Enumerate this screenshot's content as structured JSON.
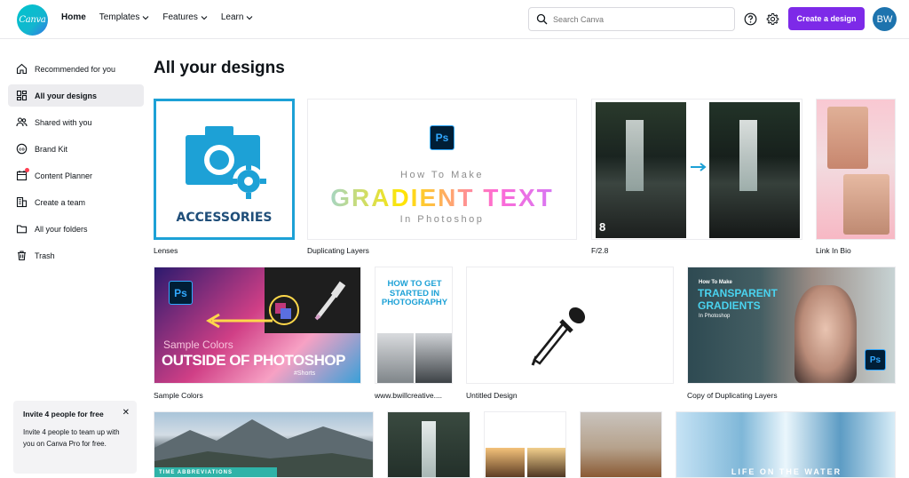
{
  "header": {
    "logo_text": "Canva",
    "nav": [
      {
        "label": "Home",
        "dropdown": false
      },
      {
        "label": "Templates",
        "dropdown": true
      },
      {
        "label": "Features",
        "dropdown": true
      },
      {
        "label": "Learn",
        "dropdown": true
      }
    ],
    "search_placeholder": "Search Canva",
    "create_button": "Create a design",
    "avatar_initials": "BW",
    "accent": "#7d2ae8"
  },
  "sidebar": {
    "items": [
      {
        "label": "Recommended for you",
        "icon": "home-icon"
      },
      {
        "label": "All your designs",
        "icon": "grid-icon",
        "active": true
      },
      {
        "label": "Shared with you",
        "icon": "people-icon"
      },
      {
        "label": "Brand Kit",
        "icon": "brand-kit-icon"
      },
      {
        "label": "Content Planner",
        "icon": "calendar-icon"
      },
      {
        "label": "Create a team",
        "icon": "building-icon"
      },
      {
        "label": "All your folders",
        "icon": "folder-icon"
      },
      {
        "label": "Trash",
        "icon": "trash-icon"
      }
    ],
    "invite": {
      "title": "Invite 4 people for free",
      "body": "Invite 4 people to team up with you on Canva Pro for free."
    }
  },
  "main": {
    "title": "All your designs",
    "designs": [
      {
        "caption": "Lenses",
        "thumb_text": "ACCESSORIES"
      },
      {
        "caption": "Duplicating Layers",
        "thumb_text": [
          "How To Make",
          "GRADIENT TEXT",
          "In Photoshop"
        ],
        "badge": "Ps"
      },
      {
        "caption": "F/2.8",
        "thumb_text": "8"
      },
      {
        "caption": "Link In Bio"
      },
      {
        "caption": "Sample Colors",
        "thumb_text": [
          "Sample Colors",
          "OUTSIDE OF PHOTOSHOP",
          "#Shorts"
        ],
        "badge": "Ps"
      },
      {
        "caption": "www.bwillcreative....",
        "thumb_text": [
          "HOW TO GET STARTED IN PHOTOGRAPHY"
        ]
      },
      {
        "caption": "Untitled Design"
      },
      {
        "caption": "Copy of Duplicating Layers",
        "thumb_text": [
          "How To Make",
          "TRANSPARENT GRADIENTS",
          "In Photoshop"
        ],
        "badge": "Ps"
      },
      {
        "caption": "",
        "thumb_text": "TIME ABBREVIATIONS"
      },
      {
        "caption": ""
      },
      {
        "caption": ""
      },
      {
        "caption": ""
      },
      {
        "caption": "",
        "thumb_text": "LIFE ON THE WATER"
      }
    ]
  }
}
